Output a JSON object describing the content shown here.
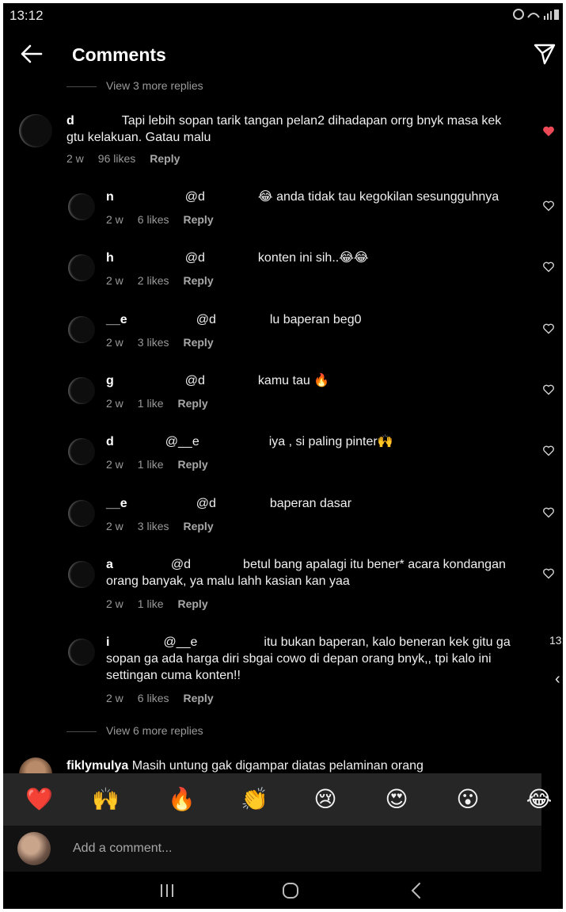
{
  "status_bar": {
    "time": "13:12",
    "icons": "alarm-icon wifi-icon signal-icon battery-icon"
  },
  "header": {
    "title": "Comments",
    "back_icon": "back-arrow-icon",
    "share_icon": "send-icon"
  },
  "view_more_top": "View 3 more replies",
  "parent_comment": {
    "username": "d",
    "text": "Tapi lebih sopan tarik tangan pelan2 dihadapan orrg bnyk masa kek gtu kelakuan. Gatau malu",
    "time": "2 w",
    "likes": "96 likes",
    "reply": "Reply",
    "liked": true
  },
  "replies": [
    {
      "username": "n",
      "mention": "@d",
      "text": "😂 anda tidak tau kegokilan sesungguhnya",
      "time": "2 w",
      "likes": "6 likes",
      "reply": "Reply"
    },
    {
      "username": "h",
      "mention": "@d",
      "text": "konten ini sih..😂😂",
      "time": "2 w",
      "likes": "2 likes",
      "reply": "Reply"
    },
    {
      "username": "__e",
      "mention": "@d",
      "text": "lu baperan beg0",
      "time": "2 w",
      "likes": "3 likes",
      "reply": "Reply"
    },
    {
      "username": "g",
      "mention": "@d",
      "text": "kamu tau 🔥",
      "time": "2 w",
      "likes": "1 like",
      "reply": "Reply"
    },
    {
      "username": "d",
      "mention": "@__e",
      "text": "iya , si paling pinter🙌",
      "time": "2 w",
      "likes": "1 like",
      "reply": "Reply"
    },
    {
      "username": "__e",
      "mention": "@d",
      "text": "baperan dasar",
      "time": "2 w",
      "likes": "3 likes",
      "reply": "Reply"
    },
    {
      "username": "a",
      "mention": "@d",
      "text": "betul bang apalagi itu bener* acara kondangan orang banyak, ya malu lahh kasian kan yaa",
      "time": "2 w",
      "likes": "1 like",
      "reply": "Reply"
    },
    {
      "username": "i",
      "mention": "@__e",
      "text": "itu bukan baperan, kalo beneran kek gitu ga sopan ga ada harga diri sbgai cowo di depan orang bnyk,, tpi kalo ini settingan cuma konten!!",
      "time": "2 w",
      "likes": "6 likes",
      "reply": "Reply"
    }
  ],
  "view_more_bottom": "View 6 more replies",
  "last_comment": {
    "username": "fiklymulya",
    "text": "Masih untung gak digampar diatas pelaminan orang"
  },
  "emoji_bar": [
    "❤️",
    "🙌",
    "🔥",
    "👏",
    "😢",
    "😍",
    "😮",
    "😂"
  ],
  "comment_input": {
    "placeholder": "Add a comment..."
  },
  "edge_overlay": {
    "time": "13:",
    "back": "‹"
  },
  "colors": {
    "background": "#000000",
    "liked_heart": "#ed4956",
    "secondary_text": "#9a9a9a"
  }
}
